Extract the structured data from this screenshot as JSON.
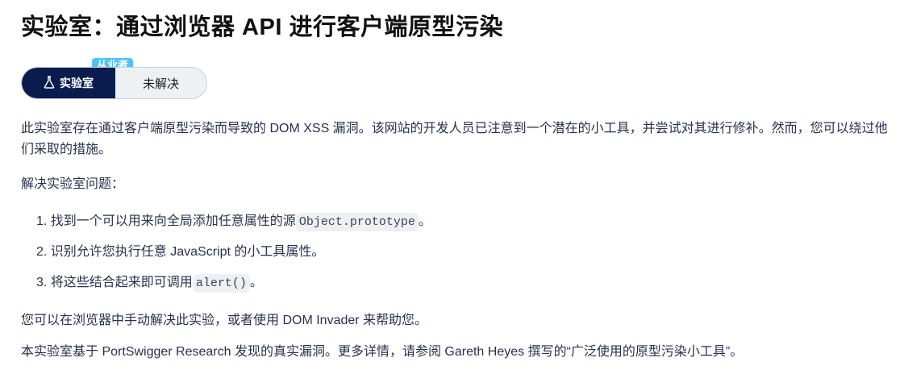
{
  "page": {
    "title": "实验室：通过浏览器 API 进行客户端原型污染"
  },
  "badge": {
    "tier": "从业者",
    "lab_label": "实验室",
    "status": "未解决",
    "lab_icon": "flask-icon"
  },
  "content": {
    "intro": "此实验室存在通过客户端原型污染而导致的 DOM XSS 漏洞。该网站的开发人员已注意到一个潜在的小工具，并尝试对其进行修补。然而，您可以绕过他们采取的措施。",
    "solve_heading": "解决实验室问题：",
    "steps": [
      {
        "num": "1.",
        "text": "找到一个可以用来向全局添加任意属性的源",
        "code": "Object.prototype",
        "suffix": "。"
      },
      {
        "num": "2.",
        "text": "识别允许您执行任意 JavaScript 的小工具属性。",
        "code": "",
        "suffix": ""
      },
      {
        "num": "3.",
        "text": "将这些结合起来即可调用",
        "code": "alert()",
        "suffix": "。"
      }
    ],
    "manual_note": "您可以在浏览器中手动解决此实验，或者使用 DOM Invader 来帮助您。",
    "research_note": "本实验室基于 PortSwigger Research 发现的真实漏洞。更多详情，请参阅 Gareth Heyes 撰写的“广泛使用的原型污染小工具”。"
  },
  "colors": {
    "lab_bg": "#0a1c4e",
    "tier_bg": "#4fc3f7",
    "text": "#27324e"
  }
}
